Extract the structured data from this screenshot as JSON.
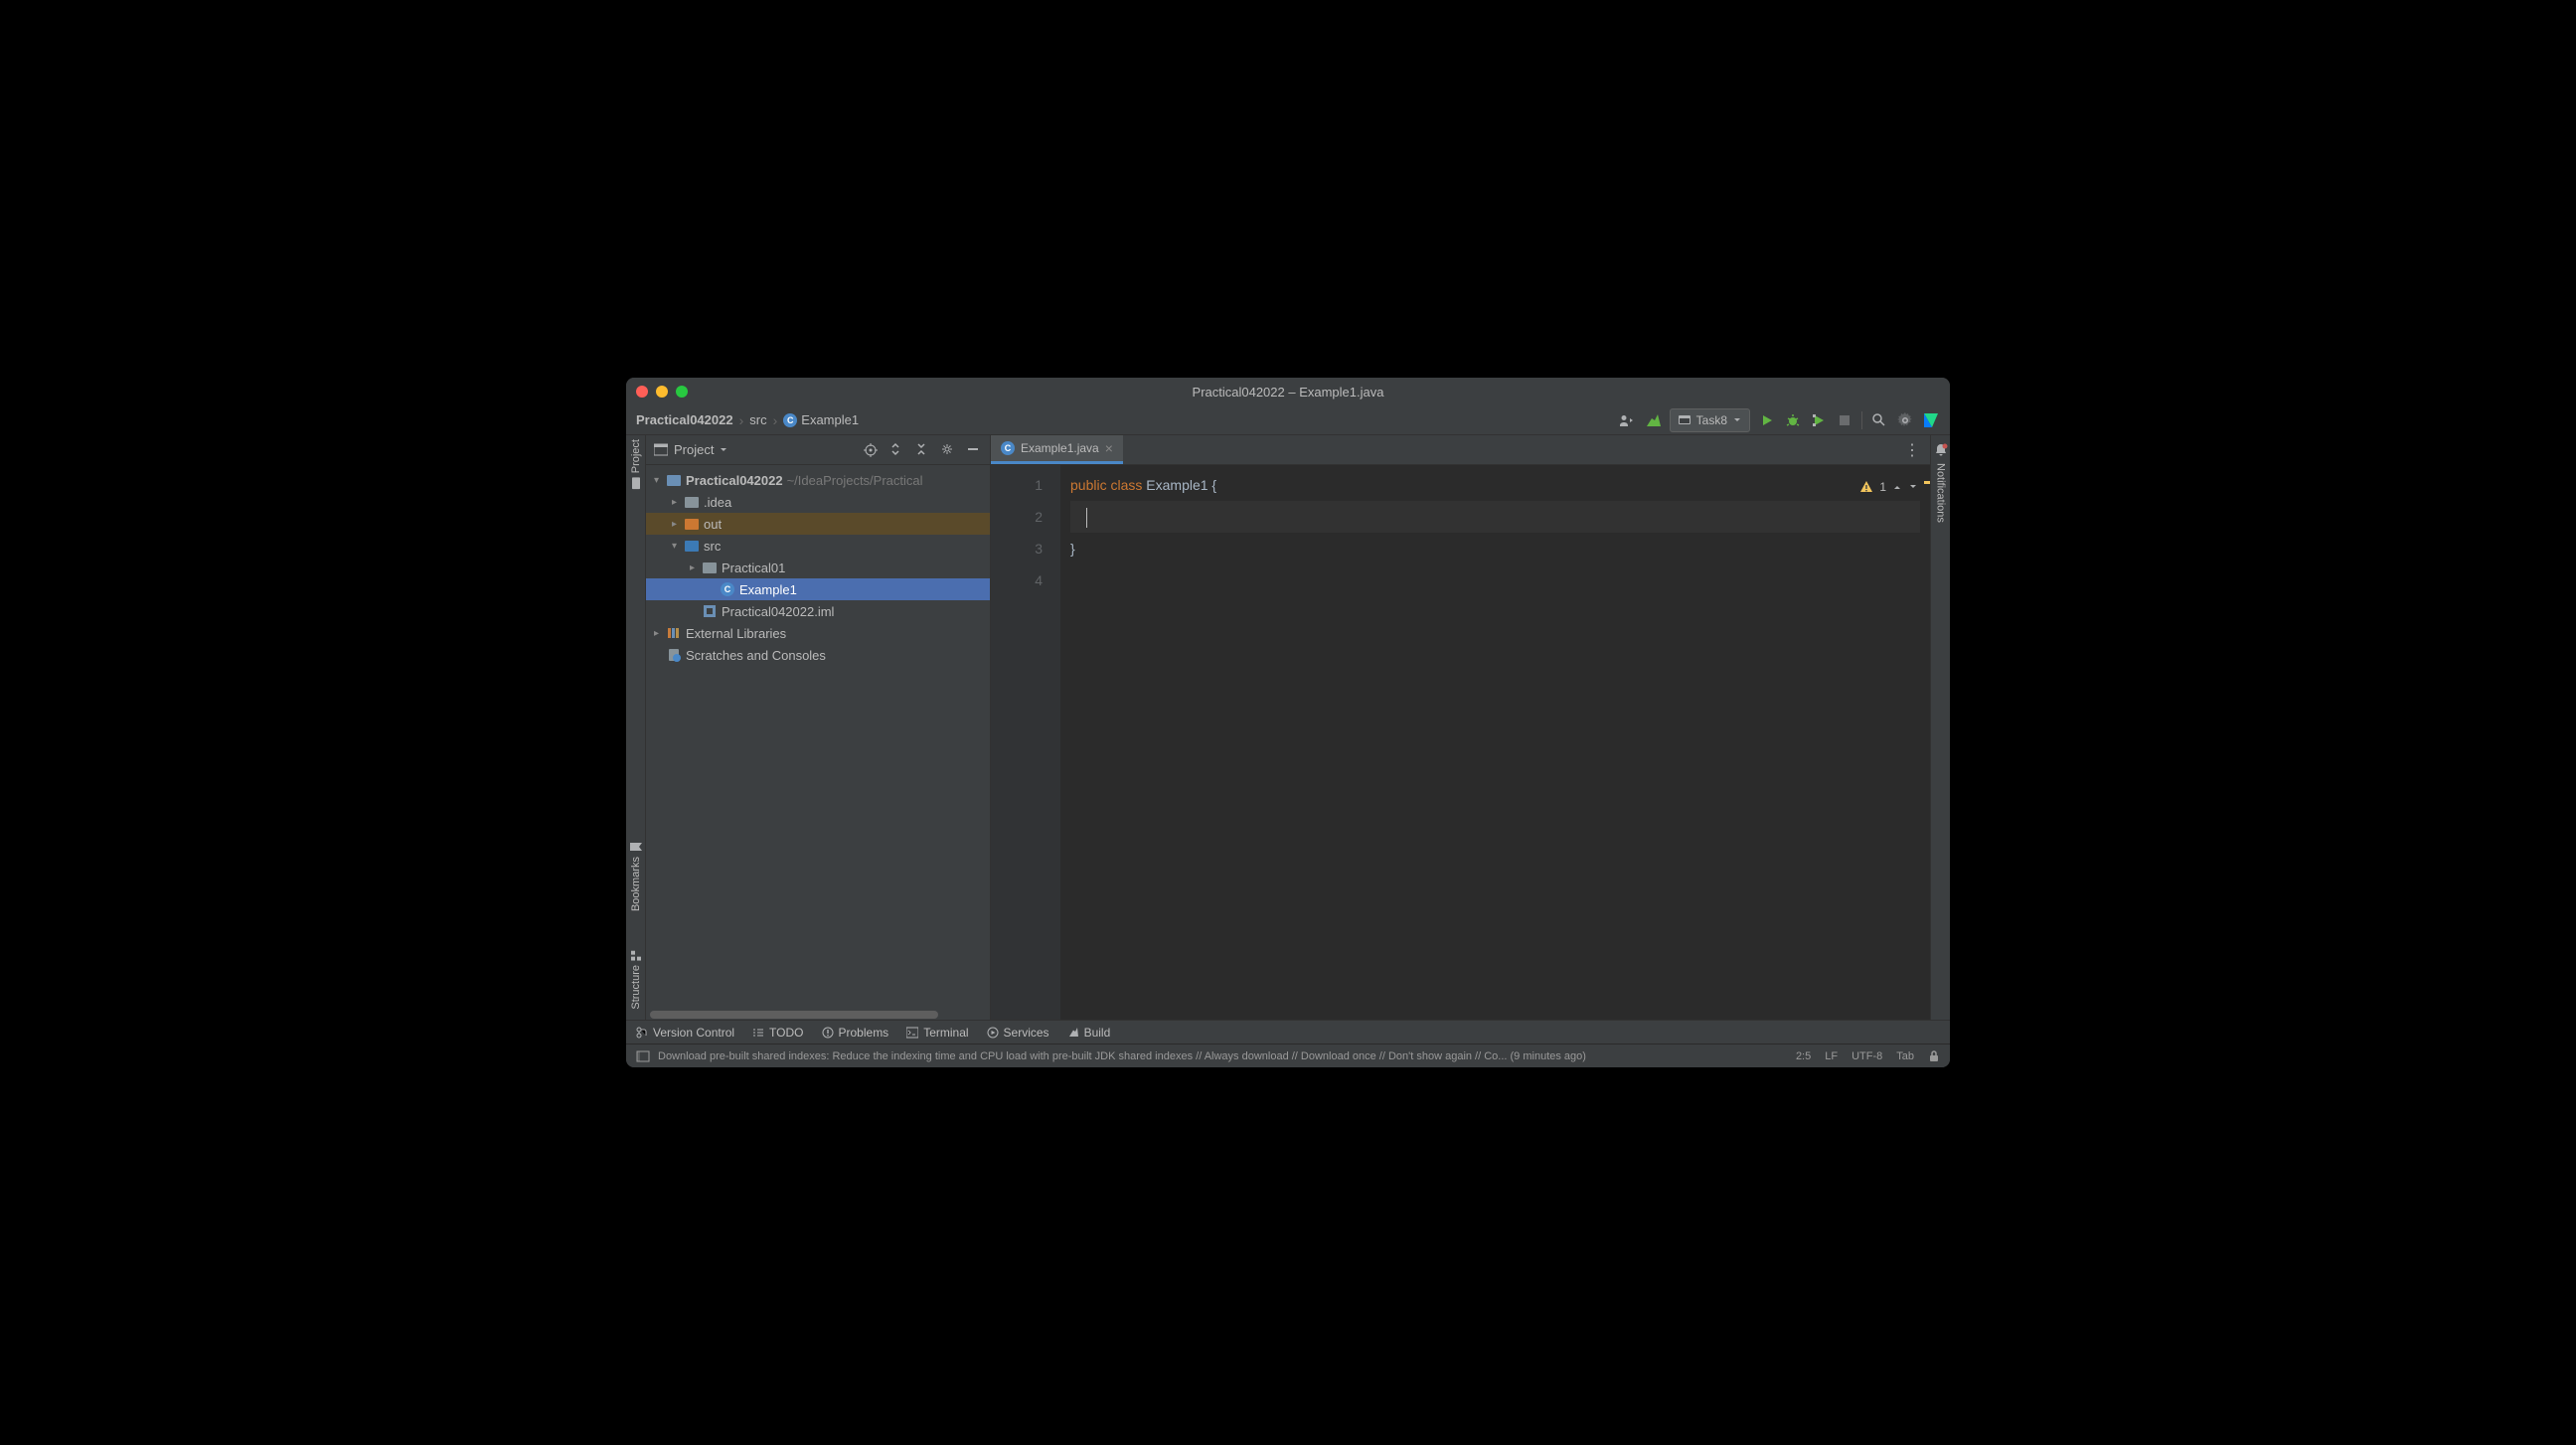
{
  "window": {
    "title": "Practical042022 – Example1.java"
  },
  "breadcrumb": {
    "root": "Practical042022",
    "folder": "src",
    "file": "Example1"
  },
  "toolbar": {
    "run_config": "Task8"
  },
  "project_panel": {
    "title": "Project"
  },
  "tree": {
    "root": {
      "name": "Practical042022",
      "path": "~/IdeaProjects/Practical"
    },
    "idea": ".idea",
    "out": "out",
    "src": "src",
    "package": "Practical01",
    "class": "Example1",
    "iml": "Practical042022.iml",
    "external": "External Libraries",
    "scratches": "Scratches and Consoles"
  },
  "tab": {
    "name": "Example1.java"
  },
  "editor": {
    "line_numbers": [
      "1",
      "2",
      "3",
      "4"
    ],
    "code": {
      "kw1": "public",
      "kw2": "class",
      "class_name": "Example1",
      "brace_open": " {",
      "indent": "    ",
      "brace_close": "}"
    },
    "inspection_count": "1"
  },
  "right_gutter": {
    "notifications": "Notifications"
  },
  "bottom_tools": {
    "vcs": "Version Control",
    "todo": "TODO",
    "problems": "Problems",
    "terminal": "Terminal",
    "services": "Services",
    "build": "Build"
  },
  "statusbar": {
    "message": "Download pre-built shared indexes: Reduce the indexing time and CPU load with pre-built JDK shared indexes // Always download // Download once // Don't show again // Co... (9 minutes ago)",
    "position": "2:5",
    "line_sep": "LF",
    "encoding": "UTF-8",
    "indent": "Tab"
  },
  "left_gutter": {
    "project": "Project",
    "bookmarks": "Bookmarks",
    "structure": "Structure"
  }
}
